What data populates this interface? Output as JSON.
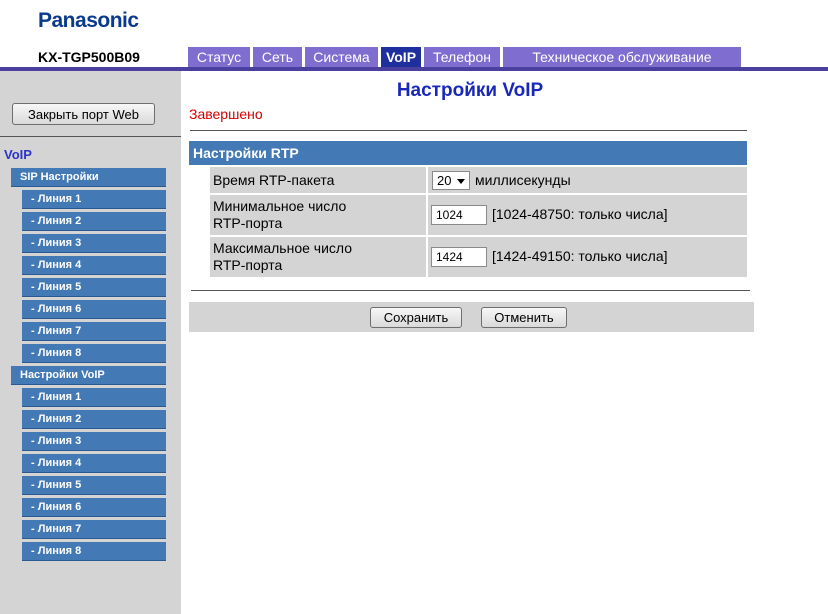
{
  "header": {
    "brand": "Panasonic",
    "model": "KX-TGP500B09",
    "tabs": [
      {
        "label": "Статус"
      },
      {
        "label": "Сеть"
      },
      {
        "label": "Система"
      },
      {
        "label": "VoIP",
        "active": true
      },
      {
        "label": "Телефон"
      },
      {
        "label": "Техническое обслуживание"
      }
    ]
  },
  "sidebar": {
    "close_button": "Закрыть порт Web",
    "section": "VoIP",
    "groups": [
      {
        "label": "SIP Настройки",
        "items": [
          "- Линия 1",
          "- Линия 2",
          "- Линия 3",
          "- Линия 4",
          "- Линия 5",
          "- Линия 6",
          "- Линия 7",
          "- Линия 8"
        ]
      },
      {
        "label": "Настройки VoIP",
        "items": [
          "- Линия 1",
          "- Линия 2",
          "- Линия 3",
          "- Линия 4",
          "- Линия 5",
          "- Линия 6",
          "- Линия 7",
          "- Линия 8"
        ]
      }
    ]
  },
  "main": {
    "title": "Настройки VoIP",
    "status": "Завершено",
    "panel_title": "Настройки RTP",
    "rows": [
      {
        "label": "Время RTP-пакета",
        "value": "20",
        "unit": "миллисекунды"
      },
      {
        "label_line1": "Минимальное число",
        "label_line2": "RTP-порта",
        "value": "1024",
        "hint": "[1024-48750: только числа]"
      },
      {
        "label_line1": "Максимальное число",
        "label_line2": "RTP-порта",
        "value": "1424",
        "hint": "[1424-49150: только числа]"
      }
    ],
    "save_label": "Сохранить",
    "cancel_label": "Отменить"
  },
  "colors": {
    "brand": "#0a3a8c",
    "tab": "#7f6ed0",
    "tab_active": "#1e2f9e",
    "panel_header": "#4379b4",
    "status": "#d40000",
    "title": "#1a28b8"
  }
}
